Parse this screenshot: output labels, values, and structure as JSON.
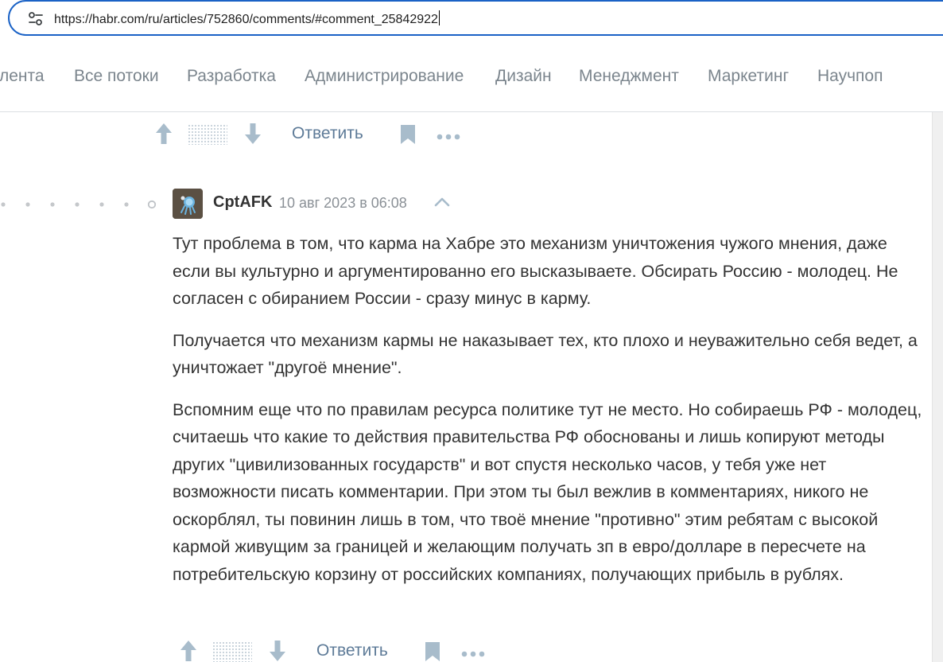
{
  "browser": {
    "url": "https://habr.com/ru/articles/752860/comments/#comment_25842922"
  },
  "nav": {
    "items": [
      {
        "label": "лента"
      },
      {
        "label": "Все потоки"
      },
      {
        "label": "Разработка"
      },
      {
        "label": "Администрирование"
      },
      {
        "label": "Дизайн"
      },
      {
        "label": "Менеджмент"
      },
      {
        "label": "Маркетинг"
      },
      {
        "label": "Научпоп"
      }
    ]
  },
  "actions": {
    "reply_label": "Ответить"
  },
  "comment": {
    "author": "CptAFK",
    "time": "10 авг 2023 в 06:08",
    "paragraphs": [
      "Тут проблема в том, что карма на Хабре это механизм уничтожения чужого мнения, даже если вы культурно и аргументированно его высказываете. Обсирать Россию - молодец. Не согласен с обиранием России - сразу минус в карму.",
      "Получается что механизм кармы не наказывает тех, кто плохо и неуважительно себя ведет, а уничтожает \"другоё мнение\".",
      "Вспомним еще что по правилам ресурса политике тут не место. Но собираешь РФ - молодец, считаешь что какие то действия правительства РФ обоснованы и лишь копируют методы других \"цивилизованных государств\" и вот спустя несколько часов, у тебя уже нет возможности писать комментарии. При этом ты был вежлив в комментариях, никого не оскорблял, ты повинин лишь в том, что твоё мнение \"противно\" этим ребятам с высокой кармой живущим за границей и желающим получать зп в евро/долларе в пересчете на потребительскую корзину от российских компаниях, получающих прибыль в рублях."
    ]
  },
  "colors": {
    "accent": "#1a62c6",
    "icon": "#a8bccb",
    "link": "#5e7b98",
    "nav_text": "#7b858d"
  }
}
